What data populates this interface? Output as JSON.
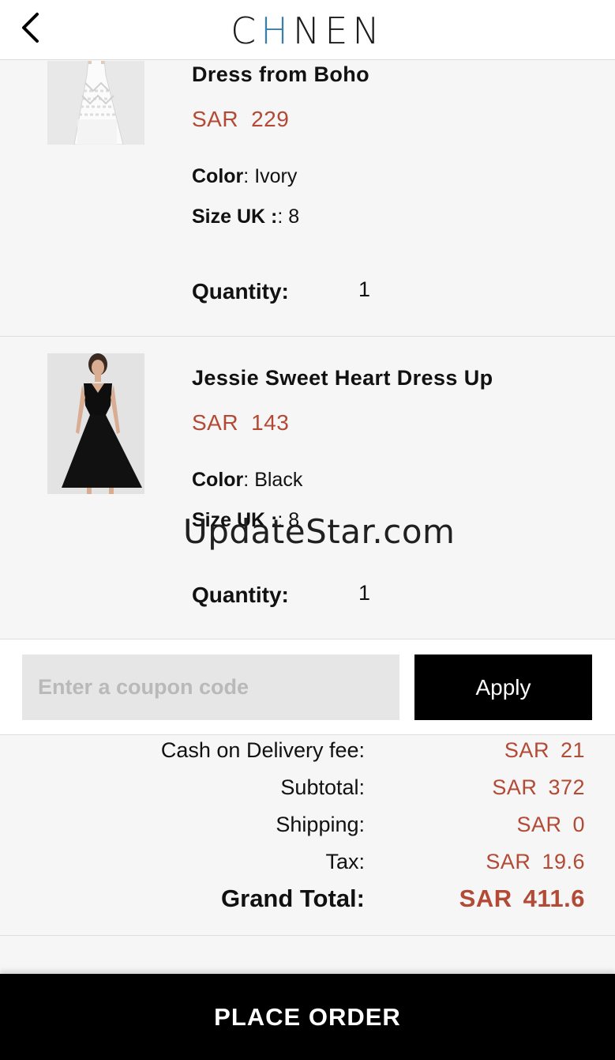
{
  "header": {
    "back_icon": "chevron-left-icon",
    "logo_parts": [
      "C",
      "H",
      "N",
      "E",
      "N"
    ]
  },
  "items": [
    {
      "name": "Dress from Boho",
      "currency": "SAR",
      "price": "229",
      "color_label": "Color",
      "color_value": "Ivory",
      "size_label": "Size UK :",
      "size_value": "8",
      "quantity_label": "Quantity:",
      "quantity": "1"
    },
    {
      "name": "Jessie Sweet Heart Dress Up",
      "currency": "SAR",
      "price": "143",
      "color_label": "Color",
      "color_value": "Black",
      "size_label": "Size UK :",
      "size_value": "8",
      "quantity_label": "Quantity:",
      "quantity": "1"
    }
  ],
  "watermark": "UpdateStar.com",
  "coupon": {
    "placeholder": "Enter a coupon code",
    "value": "",
    "apply_label": "Apply"
  },
  "totals": [
    {
      "label": "Cash on Delivery fee:",
      "currency": "SAR",
      "value": "21"
    },
    {
      "label": "Subtotal:",
      "currency": "SAR",
      "value": "372"
    },
    {
      "label": "Shipping:",
      "currency": "SAR",
      "value": "0"
    },
    {
      "label": "Tax:",
      "currency": "SAR",
      "value": "19.6"
    }
  ],
  "grand_total": {
    "label": "Grand Total:",
    "currency": "SAR",
    "value": "411.6"
  },
  "place_order_label": "PLACE ORDER",
  "colors": {
    "price": "#b24a35",
    "button_bg": "#000000",
    "logo_accent": "#3a7fa6"
  }
}
